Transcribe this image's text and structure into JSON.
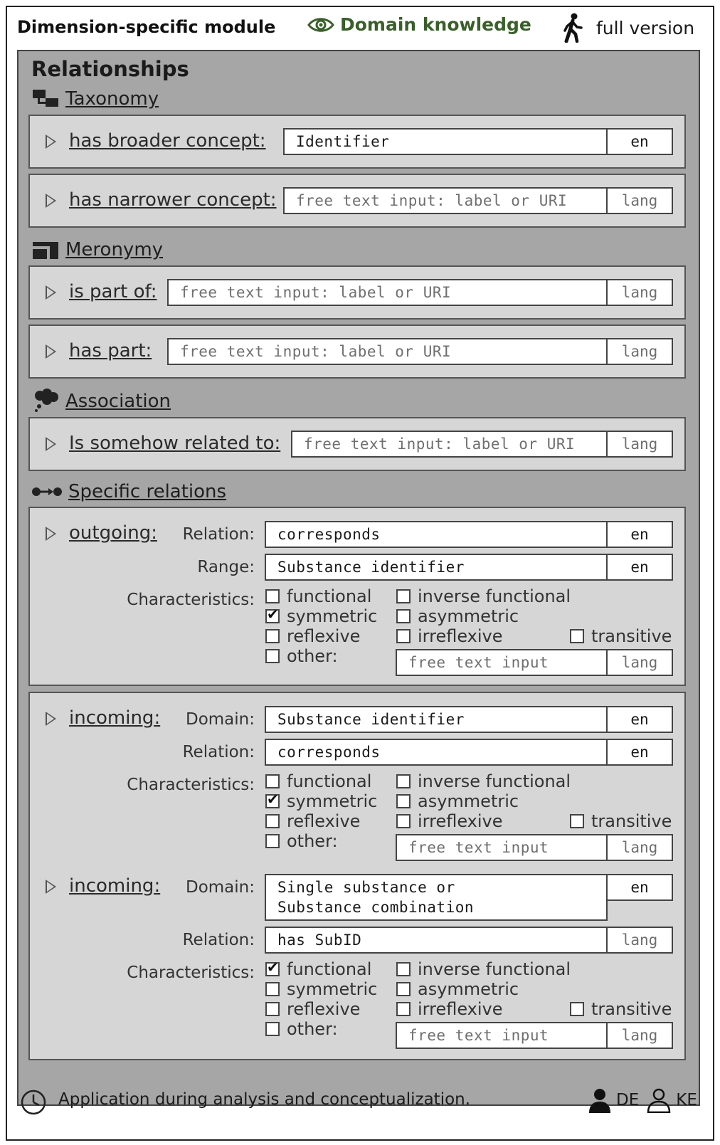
{
  "header": {
    "module": "Dimension-specific module",
    "mode": "Domain knowledge",
    "version": "full version"
  },
  "panel_title": "Relationships",
  "taxonomy": {
    "title": "Taxonomy",
    "broader": {
      "label": "has broader concept:",
      "value": "Identifier",
      "lang": "en"
    },
    "narrower": {
      "label": "has narrower concept:",
      "value": "free text input: label or URI",
      "lang": "lang"
    }
  },
  "meronymy": {
    "title": "Meronymy",
    "part_of": {
      "label": "is part of:",
      "value": "free text input: label or URI",
      "lang": "lang"
    },
    "has_part": {
      "label": "has part:",
      "value": "free text input: label or URI",
      "lang": "lang"
    }
  },
  "association": {
    "title": "Association",
    "related": {
      "label": "Is somehow related to:",
      "value": "free text input: label or URI",
      "lang": "lang"
    }
  },
  "specific": {
    "title": "Specific relations",
    "outgoing": {
      "label": "outgoing:",
      "relation_label": "Relation:",
      "relation": "corresponds",
      "relation_lang": "en",
      "range_label": "Range:",
      "range": "Substance identifier",
      "range_lang": "en",
      "char_label": "Characteristics:",
      "other_value": "free text input",
      "other_lang": "lang"
    },
    "incoming1": {
      "label": "incoming:",
      "domain_label": "Domain:",
      "domain": "Substance identifier",
      "domain_lang": "en",
      "relation_label": "Relation:",
      "relation": "corresponds",
      "relation_lang": "en",
      "char_label": "Characteristics:",
      "other_value": "free text input",
      "other_lang": "lang"
    },
    "incoming2": {
      "label": "incoming:",
      "domain_label": "Domain:",
      "domain_line1": "Single substance or",
      "domain_line2": "Substance combination",
      "domain_lang": "en",
      "relation_label": "Relation:",
      "relation": "has SubID",
      "relation_lang": "lang",
      "char_label": "Characteristics:",
      "other_value": "free text input",
      "other_lang": "lang"
    }
  },
  "characteristics": {
    "functional": "functional",
    "symmetric": "symmetric",
    "reflexive": "reflexive",
    "other": "other:",
    "inverse_functional": "inverse functional",
    "asymmetric": "asymmetric",
    "irreflexive": "irreflexive",
    "transitive": "transitive"
  },
  "checked": {
    "outgoing": [
      "symmetric"
    ],
    "incoming1": [
      "symmetric"
    ],
    "incoming2": [
      "functional"
    ]
  },
  "footer": {
    "text": "Application during analysis and conceptualization.",
    "role1": "DE",
    "role2": "KE"
  }
}
